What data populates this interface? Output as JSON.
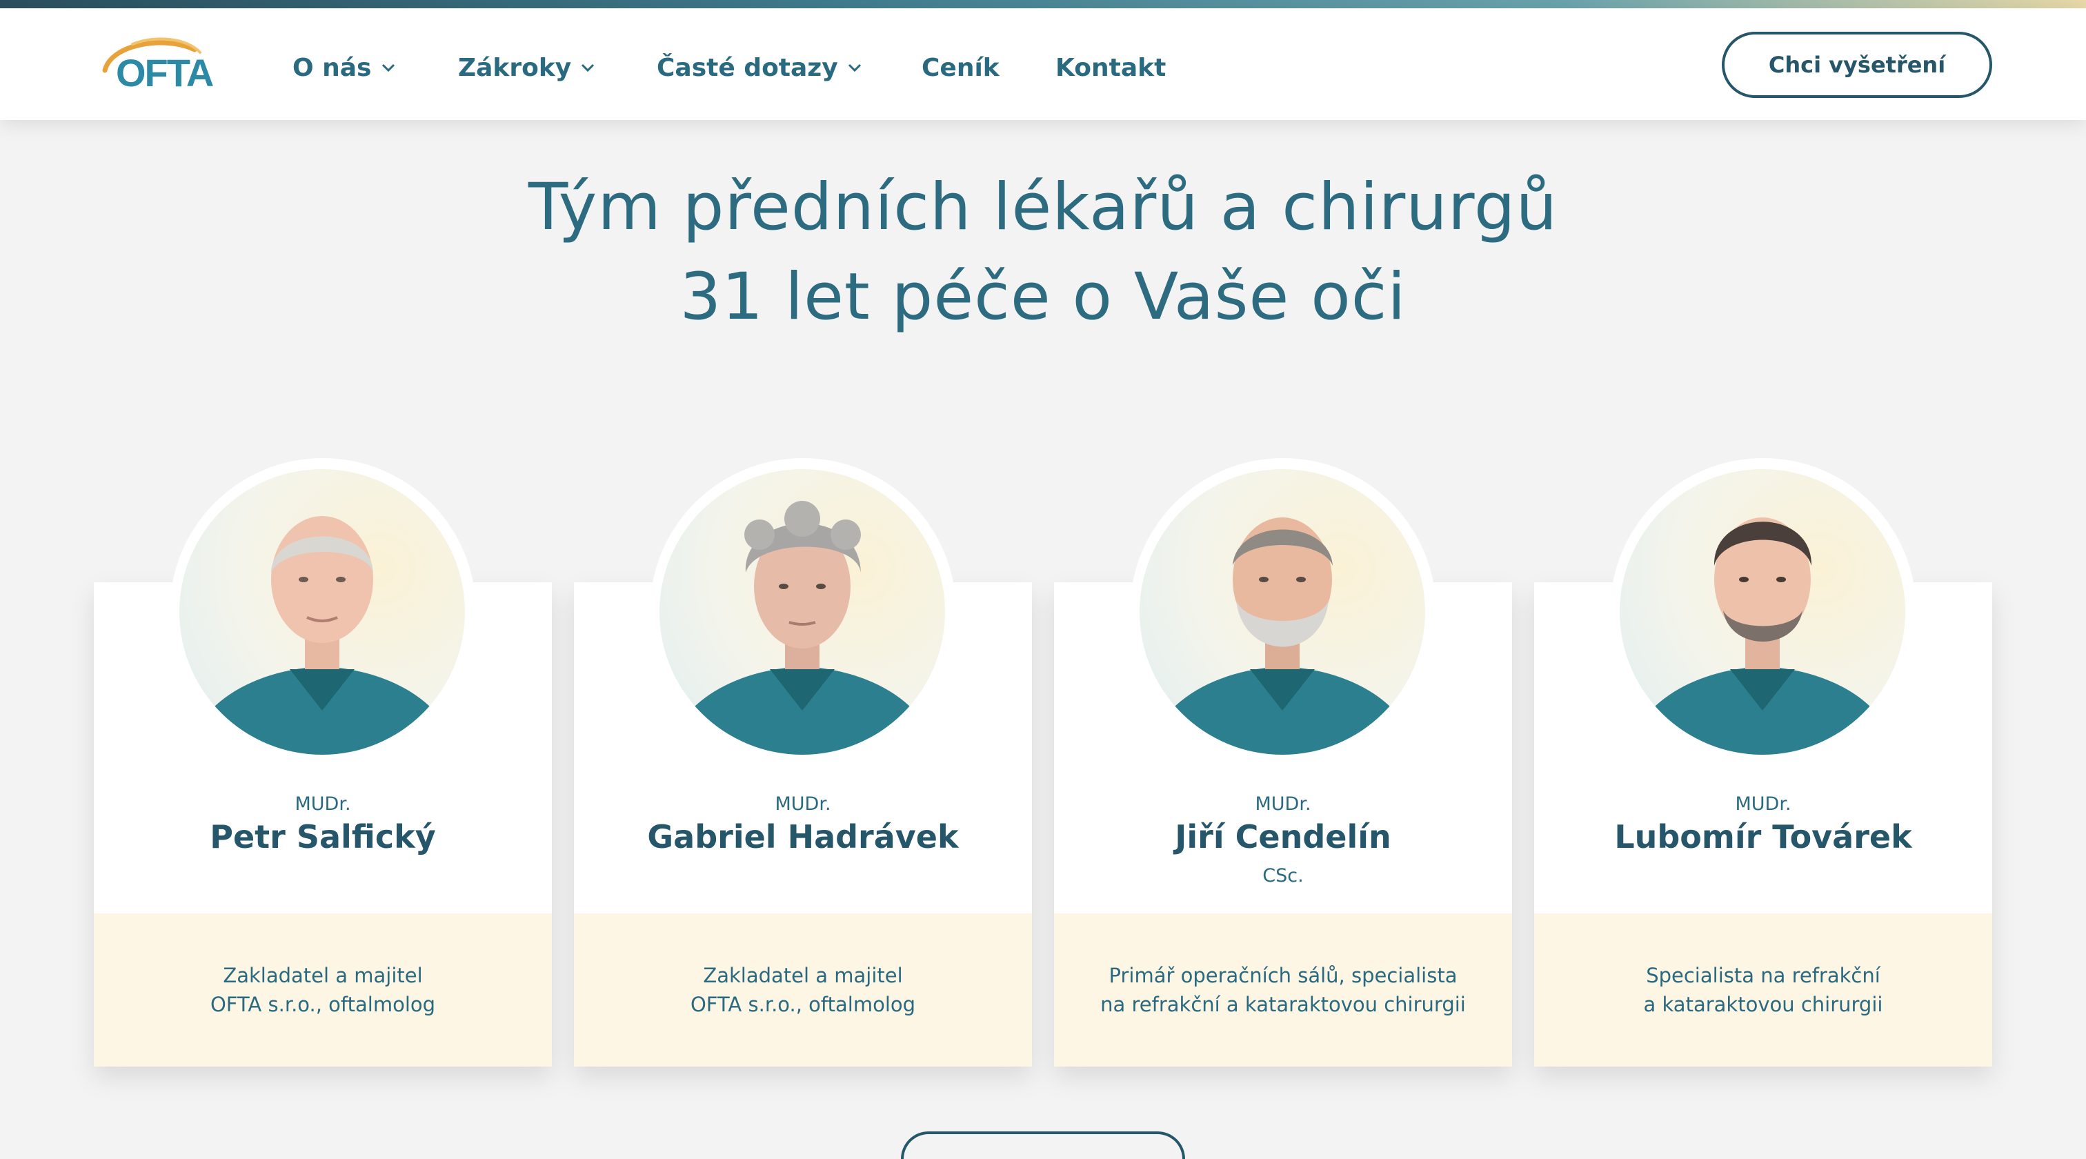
{
  "brand": {
    "logo_text": "OFTA",
    "accent": "#2a6a80",
    "dark": "#25566a",
    "cream": "#fdf6e4"
  },
  "nav": {
    "items": [
      {
        "label": "O nás",
        "dropdown": true
      },
      {
        "label": "Zákroky",
        "dropdown": true
      },
      {
        "label": "Časté dotazy",
        "dropdown": true
      },
      {
        "label": "Ceník",
        "dropdown": false
      },
      {
        "label": "Kontakt",
        "dropdown": false
      }
    ],
    "cta_label": "Chci vyšetření"
  },
  "hero": {
    "line1": "Tým předních lékařů a chirurgů",
    "line2": "31 let péče o Vaše oči"
  },
  "doctors": [
    {
      "title": "MUDr.",
      "name": "Petr Salfický",
      "suffix": "",
      "desc_line1": "Zakladatel a majitel",
      "desc_line2": "OFTA s.r.o., oftalmolog",
      "hair": "light-grey",
      "beard": false
    },
    {
      "title": "MUDr.",
      "name": "Gabriel Hadrávek",
      "suffix": "",
      "desc_line1": "Zakladatel a majitel",
      "desc_line2": "OFTA s.r.o., oftalmolog",
      "hair": "curly-grey",
      "beard": false
    },
    {
      "title": "MUDr.",
      "name": "Jiří Cendelín",
      "suffix": "CSc.",
      "desc_line1": "Primář operačních sálů, specialista",
      "desc_line2": "na refrakční a kataraktovou chirurgii",
      "hair": "grey",
      "beard": true
    },
    {
      "title": "MUDr.",
      "name": "Lubomír Továrek",
      "suffix": "",
      "desc_line1": "Specialista na refrakční",
      "desc_line2": "a kataraktovou chirurgii",
      "hair": "dark",
      "beard": true
    }
  ]
}
